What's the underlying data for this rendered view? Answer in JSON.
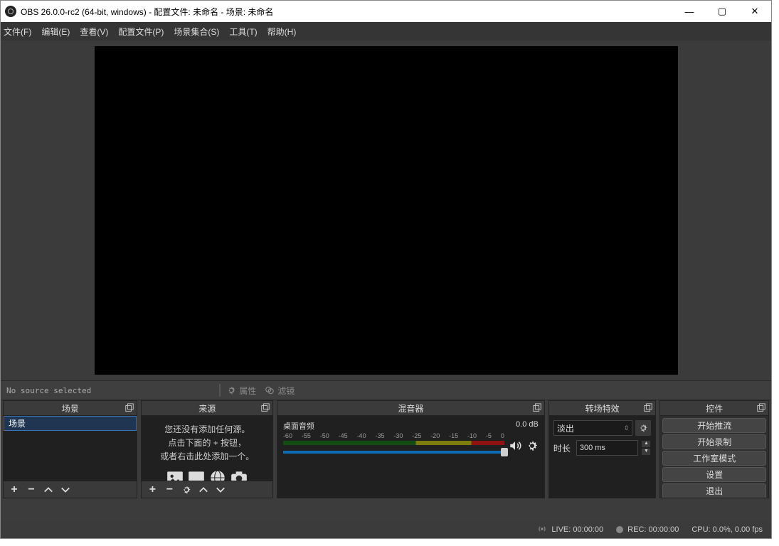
{
  "window": {
    "title": "OBS 26.0.0-rc2 (64-bit, windows) - 配置文件: 未命名 - 场景: 未命名"
  },
  "menu": {
    "file": "文件(F)",
    "edit": "编辑(E)",
    "view": "查看(V)",
    "profile": "配置文件(P)",
    "scenecoll": "场景集合(S)",
    "tools": "工具(T)",
    "help": "帮助(H)"
  },
  "toolbar": {
    "no_source": "No source selected",
    "properties": "属性",
    "filters": "滤镜"
  },
  "docks": {
    "scenes": {
      "title": "场景",
      "items": [
        "场景"
      ]
    },
    "sources": {
      "title": "来源",
      "empty_line1": "您还没有添加任何源。",
      "empty_line2": "点击下面的 + 按钮，",
      "empty_line3": "或者右击此处添加一个。"
    },
    "mixer": {
      "title": "混音器",
      "track_name": "桌面音频",
      "level_db": "0.0 dB",
      "ticks": [
        "-60",
        "-55",
        "-50",
        "-45",
        "-40",
        "-35",
        "-30",
        "-25",
        "-20",
        "-15",
        "-10",
        "-5",
        "0"
      ]
    },
    "transitions": {
      "title": "转场特效",
      "selected": "淡出",
      "duration_label": "时长",
      "duration_value": "300 ms"
    },
    "controls": {
      "title": "控件",
      "buttons": [
        "开始推流",
        "开始录制",
        "工作室模式",
        "设置",
        "退出"
      ]
    }
  },
  "statusbar": {
    "live": "LIVE: 00:00:00",
    "rec": "REC: 00:00:00",
    "cpu": "CPU: 0.0%, 0.00 fps"
  }
}
